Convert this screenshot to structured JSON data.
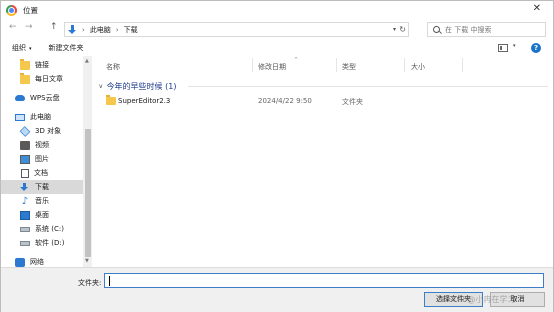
{
  "window": {
    "title": "位置",
    "close_glyph": "✕"
  },
  "navigation": {
    "back_glyph": "←",
    "forward_glyph": "→",
    "up_glyph": "↑",
    "breadcrumbs": [
      "此电脑",
      "下载"
    ],
    "separator": "›",
    "dropdown_glyph": "▾",
    "refresh_glyph": "↻"
  },
  "search": {
    "placeholder": "在 下载 中搜索"
  },
  "toolbar": {
    "organize_label": "组织",
    "organize_caret": "▾",
    "new_folder_label": "新建文件夹",
    "view_caret": "▾",
    "help_glyph": "?"
  },
  "sidebar": {
    "items": [
      {
        "label": "链接",
        "icon": "folder-icon"
      },
      {
        "label": "每日文章",
        "icon": "folder-icon"
      },
      {
        "label": "WPS云盘",
        "icon": "cloud-icon"
      },
      {
        "label": "此电脑",
        "icon": "computer-icon"
      },
      {
        "label": "3D 对象",
        "icon": "cube-icon"
      },
      {
        "label": "视频",
        "icon": "video-icon"
      },
      {
        "label": "图片",
        "icon": "picture-icon"
      },
      {
        "label": "文档",
        "icon": "document-icon"
      },
      {
        "label": "下载",
        "icon": "download-icon",
        "selected": true
      },
      {
        "label": "音乐",
        "icon": "music-icon",
        "glyph": "♪"
      },
      {
        "label": "桌面",
        "icon": "desktop-icon"
      },
      {
        "label": "系统 (C:)",
        "icon": "drive-icon"
      },
      {
        "label": "软件 (D:)",
        "icon": "drive-icon"
      },
      {
        "label": "网络",
        "icon": "network-icon"
      }
    ],
    "scroll_up_glyph": "▲",
    "scroll_down_glyph": "▼"
  },
  "file_list": {
    "columns": {
      "name": "名称",
      "modified": "修改日期",
      "type": "类型",
      "size": "大小"
    },
    "sort_caret": "^",
    "group": {
      "label": "今年的早些时候 (1)",
      "chevron": "v"
    },
    "rows": [
      {
        "name": "SuperEditor2.3",
        "modified": "2024/4/22 9:50",
        "type": "文件夹",
        "size": ""
      }
    ]
  },
  "footer": {
    "filename_label": "文件夹:",
    "filename_value": "",
    "select_button": "选择文件夹",
    "cancel_button": "取消"
  },
  "watermark": "CSDN @小冉在学习"
}
